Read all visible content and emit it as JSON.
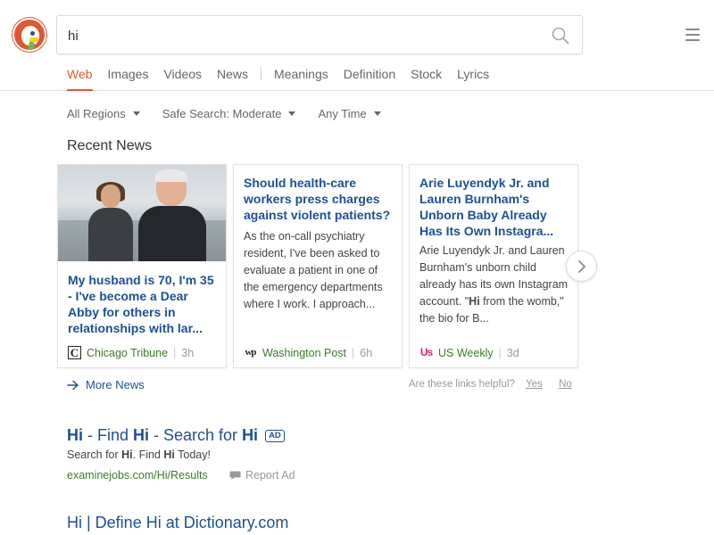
{
  "search": {
    "query": "hi",
    "placeholder": ""
  },
  "tabs": [
    {
      "label": "Web",
      "active": true
    },
    {
      "label": "Images"
    },
    {
      "label": "Videos"
    },
    {
      "label": "News"
    },
    {
      "label": "Meanings"
    },
    {
      "label": "Definition"
    },
    {
      "label": "Stock"
    },
    {
      "label": "Lyrics"
    }
  ],
  "filters": {
    "region": "All Regions",
    "safe_search": "Safe Search: Moderate",
    "time": "Any Time"
  },
  "recent_news": {
    "heading": "Recent News",
    "cards": [
      {
        "title": "My husband is 70, I'm 35 - I've become a Dear Abby for others in relationships with lar...",
        "source": "Chicago Tribune",
        "source_icon": "C",
        "time": "3h"
      },
      {
        "title": "Should health-care workers press charges against violent patients?",
        "snippet": "As the on-call psychiatry resident, I've been asked to evaluate a patient in one of the emergency departments where I work. I approach...",
        "source": "Washington Post",
        "source_icon": "wp",
        "time": "6h"
      },
      {
        "title": "Arie Luyendyk Jr. and Lauren Burnham's Unborn Baby Already Has Its Own Instagra...",
        "snippet_before": "Arie Luyendyk Jr. and Lauren Burnham's unborn child already has its own Instagram account. \"",
        "snippet_bold": "Hi",
        "snippet_after": " from the womb,\" the bio for B...",
        "source": "US Weekly",
        "source_icon": "Us",
        "time": "3d"
      }
    ],
    "more_news": "More News",
    "helpful_question": "Are these links helpful?",
    "helpful_yes": "Yes",
    "helpful_no": "No"
  },
  "results": [
    {
      "title_parts": [
        "Hi",
        " - Find ",
        "Hi",
        " - Search for ",
        "Hi"
      ],
      "ad_badge": "AD",
      "snippet_parts": [
        "Search for ",
        "Hi",
        ". Find ",
        "Hi",
        " Today!"
      ],
      "url": "examinejobs.com/Hi/Results",
      "report_ad": "Report Ad"
    },
    {
      "title": "Hi | Define Hi at Dictionary.com"
    }
  ],
  "colors": {
    "accent": "#de5833",
    "link": "#1e4f95",
    "url_green": "#3d7a2a"
  }
}
